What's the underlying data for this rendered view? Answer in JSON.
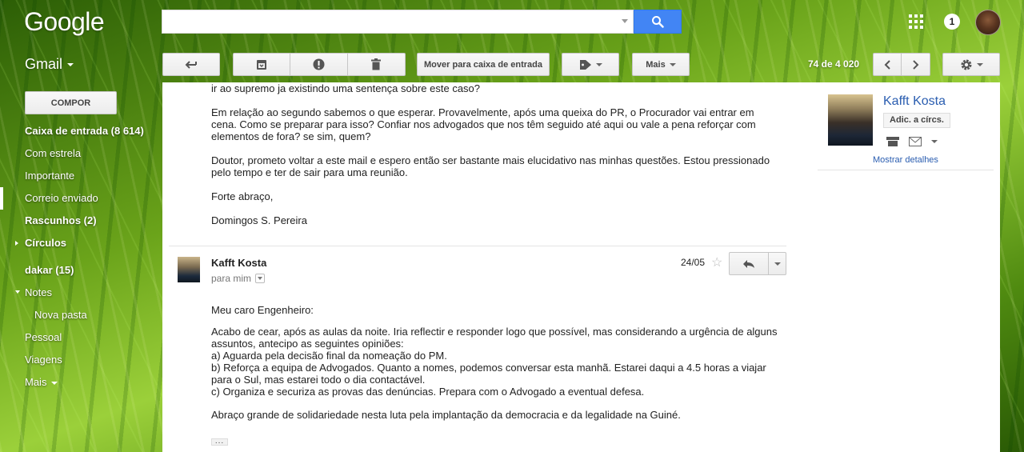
{
  "header": {
    "logo": "Google",
    "search_placeholder": "",
    "notification_count": "1"
  },
  "app": {
    "name": "Gmail"
  },
  "toolbar": {
    "move_inbox_label": "Mover para caixa de entrada",
    "more_label": "Mais",
    "pagination": "74 de 4 020"
  },
  "sidebar": {
    "compose_label": "COMPOR",
    "items": [
      {
        "label": "Caixa de entrada (8 614)"
      },
      {
        "label": "Com estrela"
      },
      {
        "label": "Importante"
      },
      {
        "label": "Correio enviado"
      },
      {
        "label": "Rascunhos (2)"
      },
      {
        "label": "Círculos"
      },
      {
        "label": "dakar (15)"
      },
      {
        "label": "Notes"
      },
      {
        "label": "Nova pasta"
      },
      {
        "label": "Pessoal"
      },
      {
        "label": "Viagens"
      },
      {
        "label": "Mais"
      }
    ]
  },
  "previous_message": {
    "paragraphs": [
      "ir ao supremo ja existindo uma sentença sobre este caso?",
      "Em relação ao segundo sabemos o que esperar. Provavelmente, após uma queixa do PR, o Procurador vai entrar em cena. Como se preparar para isso? Confiar nos advogados que nos têm seguido até aqui ou vale a pena reforçar com elementos de fora? se sim, quem?",
      "Doutor, prometo voltar a este mail e espero então ser bastante mais elucidativo nas minhas questões. Estou pressionado pelo tempo e ter de sair para uma reunião.",
      "Forte abraço,",
      "Domingos S. Pereira"
    ]
  },
  "message": {
    "sender": "Kafft Kosta",
    "to": "para mim",
    "date": "24/05",
    "greeting": "Meu caro Engenheiro:",
    "body_lines": [
      "Acabo de cear, após as aulas da noite. Iria reflectir e responder logo que possível, mas considerando a urgência de alguns assuntos, antecipo as seguintes opiniões:",
      "a) Aguarda pela decisão final da nomeação do PM.",
      "b) Reforça a equipa de Advogados. Quanto a nomes, podemos conversar esta manhã. Estarei daqui a 4.5 horas a viajar para o Sul, mas estarei todo o dia contactável.",
      "c) Organiza e securiza as provas das denúncias. Prepara com o Advogado a eventual defesa."
    ],
    "closing": "Abraço grande de solidariedade nesta luta pela implantação da democracia e da legalidade na Guiné.",
    "ellipsis": "..."
  },
  "contact_card": {
    "name": "Kafft Kosta",
    "add_circles_label": "Adic. a círcs.",
    "show_details_label": "Mostrar detalhes"
  }
}
